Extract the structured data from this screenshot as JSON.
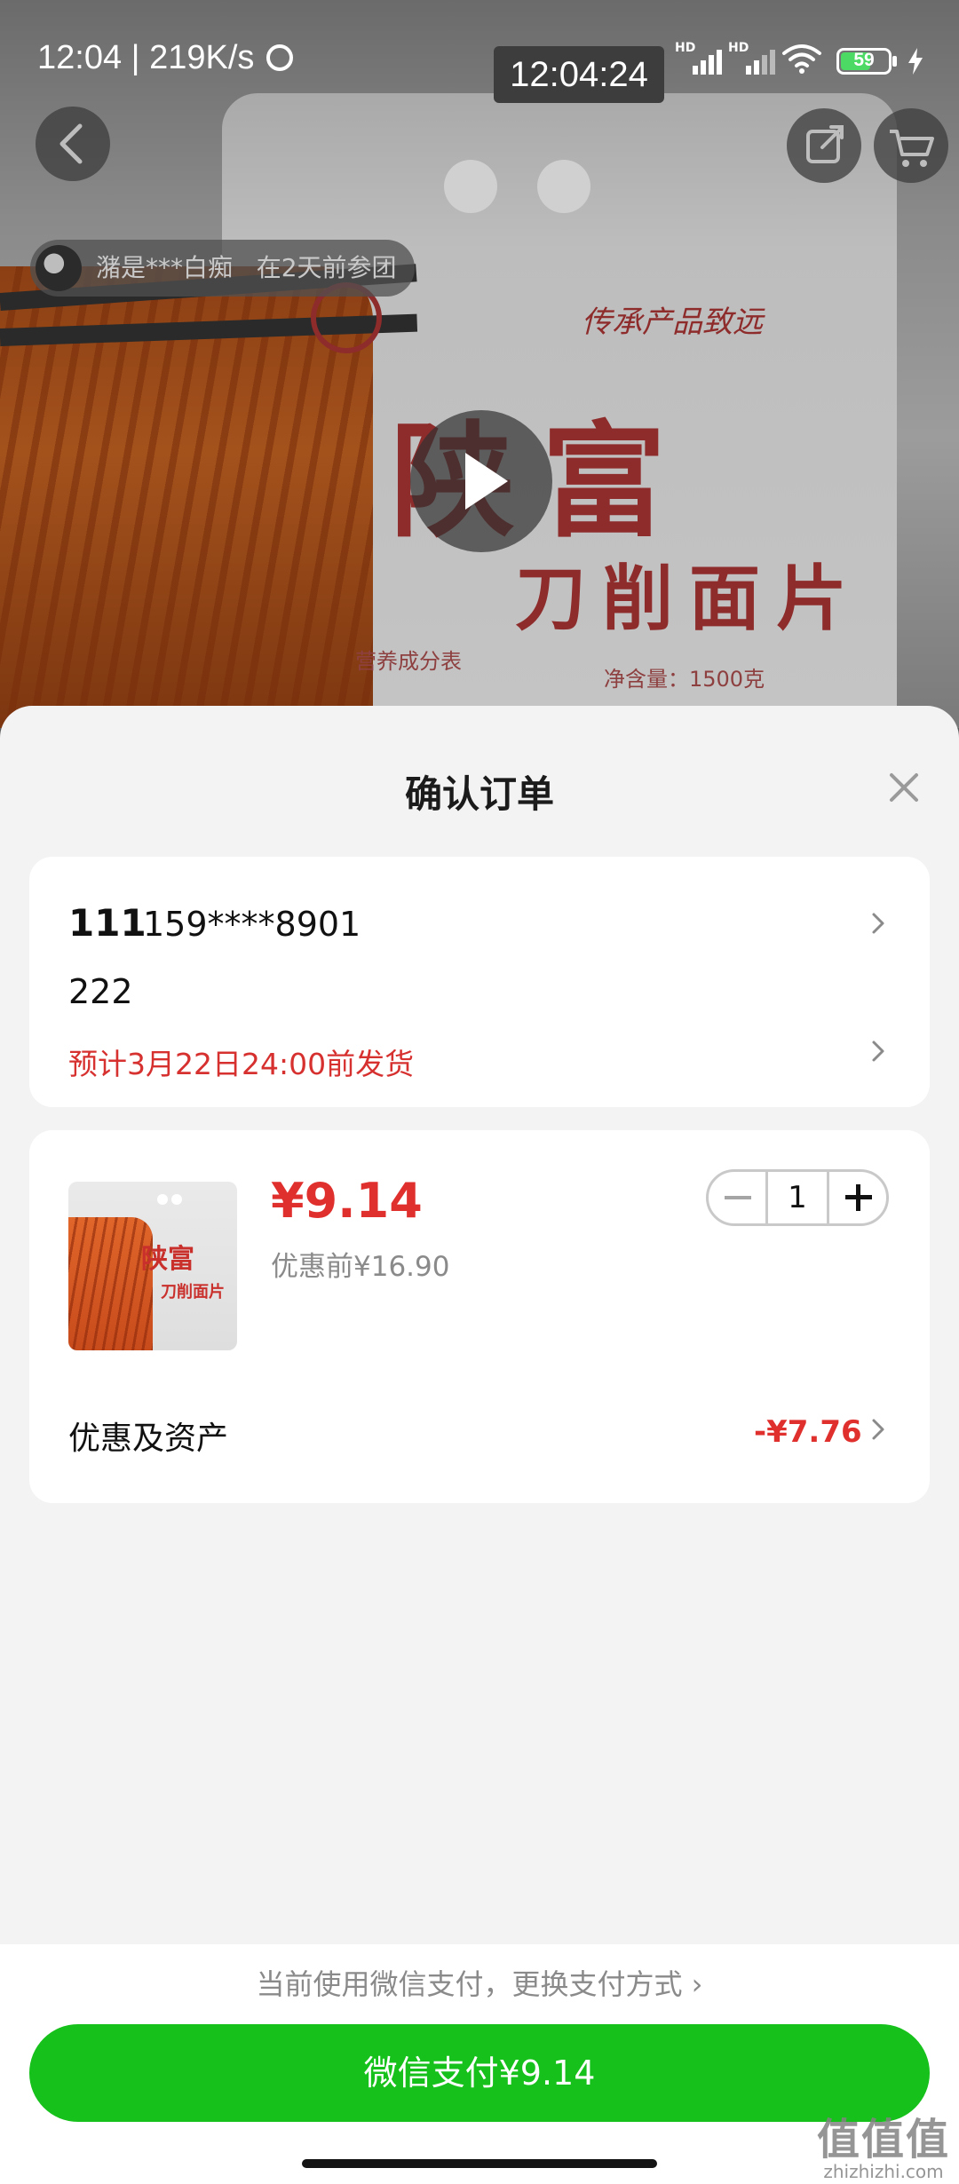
{
  "status_bar": {
    "time": "12:04",
    "speed": "219K/s",
    "clock_overlay": "12:04:24",
    "signal_label_1": "HD",
    "signal_label_2": "HD",
    "battery": "59"
  },
  "background_product": {
    "group_buy_user": "潴是***白痴",
    "group_buy_text": "在2天前参团",
    "brand_name": "陕富",
    "product_subtitle": "刀削面片",
    "slogan": "传承产品致远",
    "net_weight": "净含量：1500克",
    "nutrition_label": "营养成分表"
  },
  "sheet": {
    "title": "确认订单"
  },
  "address": {
    "name": "111",
    "phone": "159****8901",
    "detail": "222",
    "shipping": "预计3月22日24:00前发货"
  },
  "item": {
    "thumb_brand": "陕富",
    "thumb_subtitle": "刀削面片",
    "price": "¥9.14",
    "original_price": "优惠前¥16.90",
    "quantity": "1",
    "discount_label": "优惠及资产",
    "discount_value": "-¥7.76"
  },
  "payment": {
    "method_text": "当前使用微信支付，更换支付方式 ›",
    "pay_button": "微信支付¥9.14"
  },
  "watermark": {
    "big": "值值值",
    "small": "zhizhizhi.com"
  },
  "colors": {
    "accent_red": "#e0302e",
    "pay_green": "#15c11a"
  }
}
